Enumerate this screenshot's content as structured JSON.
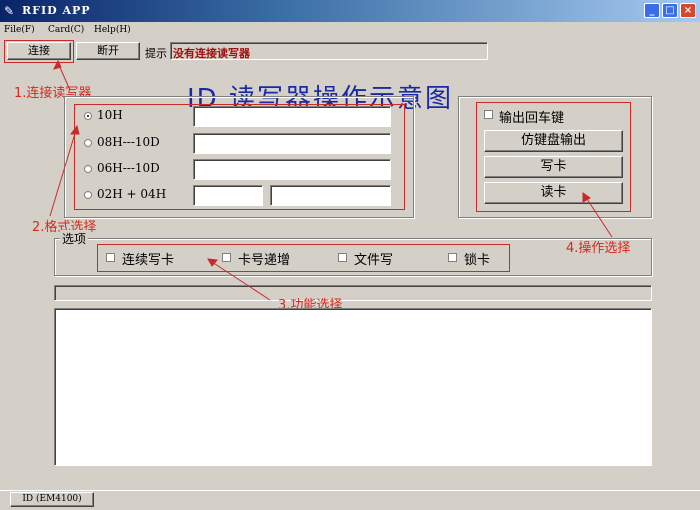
{
  "window": {
    "title": "RFID APP",
    "min": "_",
    "max": "□",
    "close": "×"
  },
  "menu": [
    "File(F)",
    "Card(C)",
    "Help(H)"
  ],
  "toolbar": {
    "connect": "连接",
    "disconnect": "断开",
    "hint_label": "提示",
    "hint_value": "没有连接读写器"
  },
  "diagram_title": "ID 读写器操作示意图",
  "annotations": {
    "connect": "1.连接读写器",
    "format": "2.格式选择",
    "function": "3.功能选择",
    "operation": "4.操作选择"
  },
  "formats": [
    {
      "label": "10H",
      "selected": true
    },
    {
      "label": "08H---10D",
      "selected": false
    },
    {
      "label": "06H---10D",
      "selected": false
    },
    {
      "label": "02H + 04H",
      "selected": false
    }
  ],
  "operations": {
    "enter_key": "输出回车键",
    "keyboard_output": "仿键盘输出",
    "write": "写卡",
    "read": "读卡"
  },
  "options": {
    "group_label": "选项",
    "items": [
      "连续写卡",
      "卡号递增",
      "文件写",
      "锁卡"
    ]
  },
  "status": {
    "tab": "ID (EM4100)"
  }
}
